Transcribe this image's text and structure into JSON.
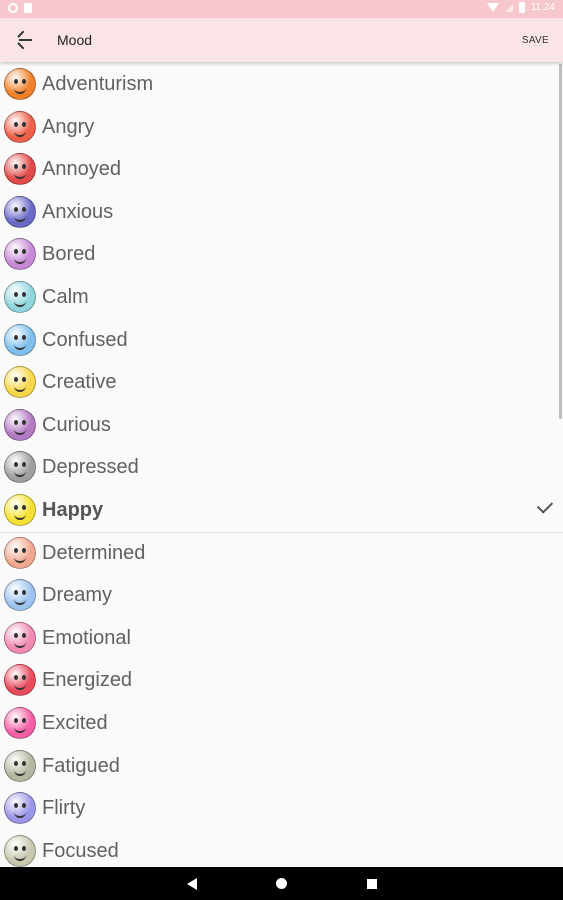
{
  "status_bar": {
    "time": "11:24"
  },
  "app_bar": {
    "title": "Mood",
    "save_label": "SAVE"
  },
  "moods": [
    {
      "label": "Adventurism",
      "icon": "sunglasses-face-icon",
      "color": "#f0812a"
    },
    {
      "label": "Angry",
      "icon": "angry-face-icon",
      "color": "#f0604a"
    },
    {
      "label": "Annoyed",
      "icon": "annoyed-face-icon",
      "color": "#e24a4a"
    },
    {
      "label": "Anxious",
      "icon": "anxious-face-icon",
      "color": "#6a6ac8"
    },
    {
      "label": "Bored",
      "icon": "bored-face-icon",
      "color": "#c88ad6"
    },
    {
      "label": "Calm",
      "icon": "calm-face-icon",
      "color": "#8fd6dc"
    },
    {
      "label": "Confused",
      "icon": "confused-face-icon",
      "color": "#7fc0ec"
    },
    {
      "label": "Creative",
      "icon": "creative-face-icon",
      "color": "#f6d84a"
    },
    {
      "label": "Curious",
      "icon": "curious-face-icon",
      "color": "#b47ac4"
    },
    {
      "label": "Depressed",
      "icon": "depressed-face-icon",
      "color": "#a0a0a0"
    },
    {
      "label": "Happy",
      "icon": "happy-face-icon",
      "color": "#f6e234",
      "selected": true
    },
    {
      "label": "Determined",
      "icon": "determined-face-icon",
      "color": "#f2a890"
    },
    {
      "label": "Dreamy",
      "icon": "dreamy-face-icon",
      "color": "#9cc4ee"
    },
    {
      "label": "Emotional",
      "icon": "emotional-face-icon",
      "color": "#f28ab4"
    },
    {
      "label": "Energized",
      "icon": "energized-face-icon",
      "color": "#e84a5e"
    },
    {
      "label": "Excited",
      "icon": "excited-face-icon",
      "color": "#f460a6"
    },
    {
      "label": "Fatigued",
      "icon": "fatigued-face-icon",
      "color": "#b4b8a0"
    },
    {
      "label": "Flirty",
      "icon": "flirty-face-icon",
      "color": "#9c96e8"
    },
    {
      "label": "Focused",
      "icon": "focused-face-icon",
      "color": "#c8c8b0"
    }
  ]
}
